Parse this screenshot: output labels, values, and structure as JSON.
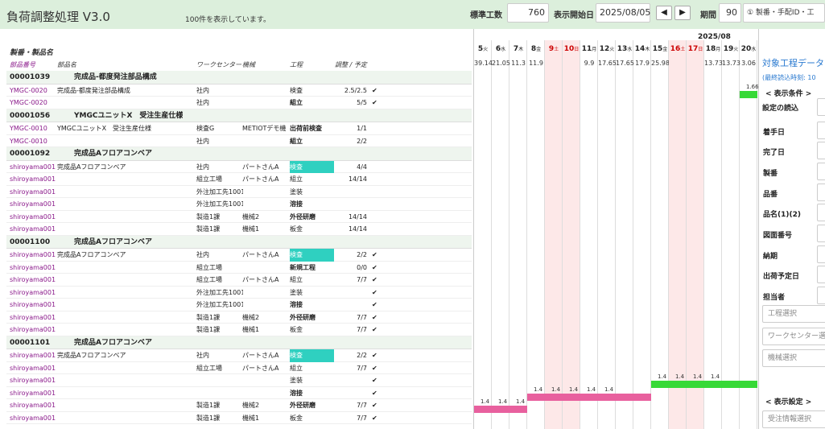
{
  "title": "負荷調整処理 V3.0",
  "status": "100件を表示しています。",
  "toolbar": {
    "std_label": "標準工数",
    "std_value": "760",
    "start_label": "表示開始日",
    "start_value": "2025/08/05",
    "prev": "◀",
    "next": "▶",
    "period_label": "期間",
    "period_value": "90",
    "filter": "① 製番・手配ID・工"
  },
  "left": {
    "section": "製番・製品名",
    "cols": [
      "部品番号",
      "部品名",
      "ワークセンター",
      "機械",
      "工程",
      "調整 / 予定"
    ]
  },
  "groups": [
    {
      "id": "00001039",
      "name": "完成品-都度発注部品構成",
      "rows": [
        {
          "part": "YMGC-0020",
          "pname": "完成品-都度発注部品構成",
          "wc": "社内",
          "mc": "",
          "proc": "検査",
          "pb": false,
          "hl": false,
          "adj": "2.5/2.5",
          "chk": true
        },
        {
          "part": "YMGC-0020",
          "pname": "",
          "wc": "社内",
          "mc": "",
          "proc": "組立",
          "pb": true,
          "hl": false,
          "adj": "5/5",
          "chk": true
        }
      ]
    },
    {
      "id": "00001056",
      "name": "YMGCユニットX　受注生産仕様",
      "rows": [
        {
          "part": "YMGC-0010",
          "pname": "YMGCユニットX　受注生産仕様",
          "wc": "検査G",
          "mc": "METIOTデモ機",
          "proc": "出荷前検査",
          "pb": true,
          "hl": false,
          "adj": "1/1",
          "chk": false
        },
        {
          "part": "YMGC-0010",
          "pname": "",
          "wc": "社内",
          "mc": "",
          "proc": "組立",
          "pb": true,
          "hl": false,
          "adj": "2/2",
          "chk": false
        }
      ]
    },
    {
      "id": "00001092",
      "name": "完成品Aフロアコンベア",
      "rows": [
        {
          "part": "shiroyama001",
          "pname": "完成品Aフロアコンベア",
          "wc": "社内",
          "mc": "パートさんA",
          "proc": "検査",
          "pb": false,
          "hl": true,
          "adj": "4/4",
          "chk": false
        },
        {
          "part": "shiroyama001",
          "pname": "",
          "wc": "組立工場",
          "mc": "パートさんA",
          "proc": "組立",
          "pb": false,
          "hl": false,
          "adj": "14/14",
          "chk": false
        },
        {
          "part": "shiroyama001",
          "pname": "",
          "wc": "外注加工先1001",
          "mc": "",
          "proc": "塗装",
          "pb": false,
          "hl": false,
          "adj": "",
          "chk": false
        },
        {
          "part": "shiroyama001",
          "pname": "",
          "wc": "外注加工先1001",
          "mc": "",
          "proc": "溶接",
          "pb": true,
          "hl": false,
          "adj": "",
          "chk": false
        },
        {
          "part": "shiroyama001",
          "pname": "",
          "wc": "製造1課",
          "mc": "機械2",
          "proc": "外径研磨",
          "pb": true,
          "hl": false,
          "adj": "14/14",
          "chk": false
        },
        {
          "part": "shiroyama001",
          "pname": "",
          "wc": "製造1課",
          "mc": "機械1",
          "proc": "板金",
          "pb": false,
          "hl": false,
          "adj": "14/14",
          "chk": false
        }
      ]
    },
    {
      "id": "00001100",
      "name": "完成品Aフロアコンベア",
      "rows": [
        {
          "part": "shiroyama001",
          "pname": "完成品Aフロアコンベア",
          "wc": "社内",
          "mc": "パートさんA",
          "proc": "検査",
          "pb": false,
          "hl": true,
          "adj": "2/2",
          "chk": true
        },
        {
          "part": "shiroyama001",
          "pname": "",
          "wc": "組立工場",
          "mc": "",
          "proc": "新規工程",
          "pb": true,
          "hl": false,
          "adj": "0/0",
          "chk": true
        },
        {
          "part": "shiroyama001",
          "pname": "",
          "wc": "組立工場",
          "mc": "パートさんA",
          "proc": "組立",
          "pb": false,
          "hl": false,
          "adj": "7/7",
          "chk": true
        },
        {
          "part": "shiroyama001",
          "pname": "",
          "wc": "外注加工先1001",
          "mc": "",
          "proc": "塗装",
          "pb": false,
          "hl": false,
          "adj": "",
          "chk": true
        },
        {
          "part": "shiroyama001",
          "pname": "",
          "wc": "外注加工先1001",
          "mc": "",
          "proc": "溶接",
          "pb": true,
          "hl": false,
          "adj": "",
          "chk": true
        },
        {
          "part": "shiroyama001",
          "pname": "",
          "wc": "製造1課",
          "mc": "機械2",
          "proc": "外径研磨",
          "pb": true,
          "hl": false,
          "adj": "7/7",
          "chk": true
        },
        {
          "part": "shiroyama001",
          "pname": "",
          "wc": "製造1課",
          "mc": "機械1",
          "proc": "板金",
          "pb": false,
          "hl": false,
          "adj": "7/7",
          "chk": true
        }
      ]
    },
    {
      "id": "00001101",
      "name": "完成品Aフロアコンベア",
      "rows": [
        {
          "part": "shiroyama001",
          "pname": "完成品Aフロアコンベア",
          "wc": "社内",
          "mc": "パートさんA",
          "proc": "検査",
          "pb": false,
          "hl": true,
          "adj": "2/2",
          "chk": true
        },
        {
          "part": "shiroyama001",
          "pname": "",
          "wc": "組立工場",
          "mc": "パートさんA",
          "proc": "組立",
          "pb": false,
          "hl": false,
          "adj": "7/7",
          "chk": true
        },
        {
          "part": "shiroyama001",
          "pname": "",
          "wc": "",
          "mc": "",
          "proc": "塗装",
          "pb": false,
          "hl": false,
          "adj": "",
          "chk": true
        },
        {
          "part": "shiroyama001",
          "pname": "",
          "wc": "",
          "mc": "",
          "proc": "溶接",
          "pb": true,
          "hl": false,
          "adj": "",
          "chk": true
        },
        {
          "part": "shiroyama001",
          "pname": "",
          "wc": "製造1課",
          "mc": "機械2",
          "proc": "外径研磨",
          "pb": true,
          "hl": false,
          "adj": "7/7",
          "chk": true
        },
        {
          "part": "shiroyama001",
          "pname": "",
          "wc": "製造1課",
          "mc": "機械1",
          "proc": "板金",
          "pb": false,
          "hl": false,
          "adj": "7/7",
          "chk": true
        }
      ]
    }
  ],
  "gantt": {
    "month": "2025/08",
    "days": [
      {
        "d": "5",
        "w": "火",
        "v": "39.14",
        "we": false
      },
      {
        "d": "6",
        "w": "水",
        "v": "21.05",
        "we": false
      },
      {
        "d": "7",
        "w": "木",
        "v": "11.3",
        "we": false
      },
      {
        "d": "8",
        "w": "金",
        "v": "11.9",
        "we": false
      },
      {
        "d": "9",
        "w": "土",
        "v": "",
        "we": true
      },
      {
        "d": "10",
        "w": "日",
        "v": "",
        "we": true
      },
      {
        "d": "11",
        "w": "月",
        "v": "9.9",
        "we": false
      },
      {
        "d": "12",
        "w": "火",
        "v": "17.65",
        "we": false
      },
      {
        "d": "13",
        "w": "水",
        "v": "17.65",
        "we": false
      },
      {
        "d": "14",
        "w": "木",
        "v": "17.9",
        "we": false
      },
      {
        "d": "15",
        "w": "金",
        "v": "25.98",
        "we": false
      },
      {
        "d": "16",
        "w": "土",
        "v": "",
        "we": true
      },
      {
        "d": "17",
        "w": "日",
        "v": "",
        "we": true
      },
      {
        "d": "18",
        "w": "月",
        "v": "13.73",
        "we": false
      },
      {
        "d": "19",
        "w": "火",
        "v": "13.73",
        "we": false
      },
      {
        "d": "20",
        "w": "水",
        "v": "3.06",
        "we": false
      }
    ],
    "bar_pink": "#e8609e",
    "bar_green": "#37d937",
    "bars": [
      {
        "row": 1,
        "from": 15,
        "to": 15,
        "color": "green",
        "labels": [
          "1.66"
        ]
      },
      {
        "row": 24,
        "from": 10,
        "to": 15,
        "color": "green",
        "labels": [
          "1.4",
          "1.4",
          "1.4",
          "1.4"
        ]
      },
      {
        "row": 25,
        "from": 3,
        "to": 9,
        "color": "pink",
        "labels": [
          "1.4",
          "1.4",
          "1.4",
          "1.4",
          "1.4"
        ]
      },
      {
        "row": 26,
        "from": 0,
        "to": 2,
        "color": "pink",
        "labels": [
          "1.4",
          "1.4",
          "1.4"
        ]
      }
    ]
  },
  "right": {
    "title": "対象工程データ",
    "sub": "(最終読込時刻: 10",
    "cond": "< 表示条件 >",
    "load_label": "設定の読込",
    "labels": [
      "着手日",
      "完了日",
      "製番",
      "品番",
      "品名(1)(2)",
      "図面番号",
      "納期",
      "出荷予定日",
      "担当者"
    ],
    "sel1": "工程選択",
    "sel2": "ワークセンター選",
    "sel3": "機械選択",
    "disp": "< 表示設定 >",
    "sel4": "受注情報選択"
  }
}
